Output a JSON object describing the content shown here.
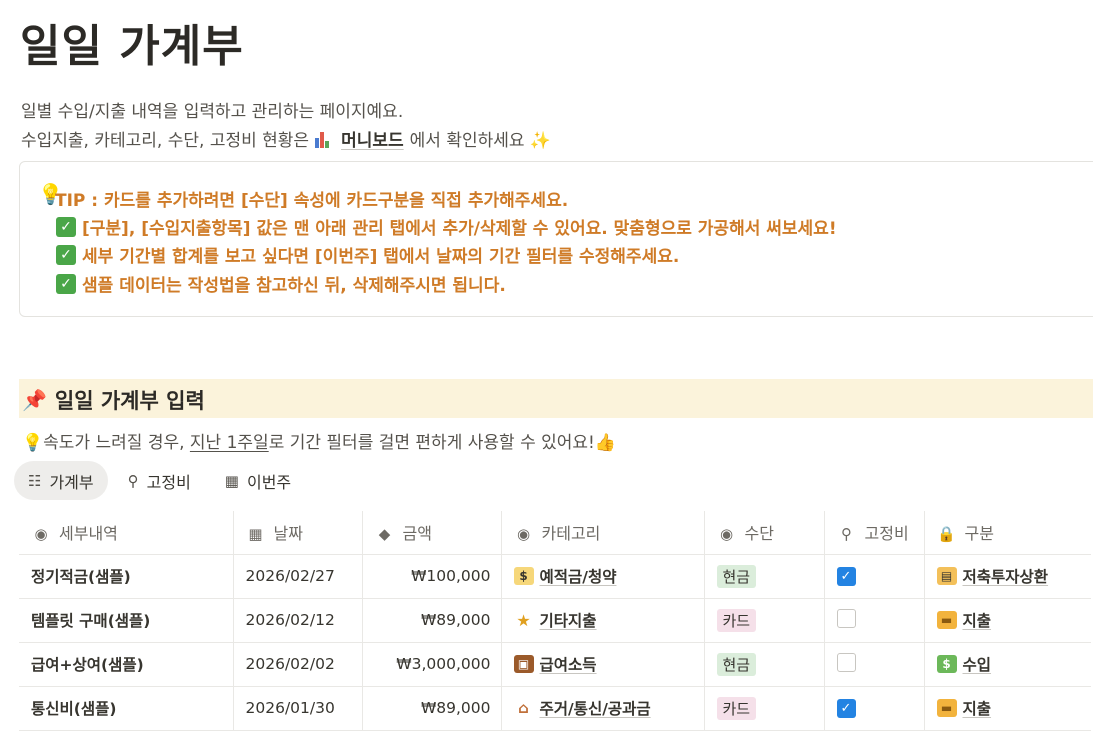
{
  "page": {
    "title": "일일 가계부",
    "desc_line1": "일별 수입/지출 내역을 입력하고 관리하는 페이지예요.",
    "desc_line2_before": "수입지출, 카테고리, 수단, 고정비 현황은",
    "desc_link": "머니보드",
    "desc_line2_after": "에서 확인하세요 ✨"
  },
  "callout": {
    "icon": "lightbulb-icon",
    "tip": "TIP : 카드를 추가하려면 [수단] 속성에 카드구분을 직접 추가해주세요.",
    "items": [
      "[구분], [수입지출항목] 값은 맨 아래 관리 탭에서 추가/삭제할 수 있어요. 맞춤형으로 가공해서 써보세요!",
      "세부 기간별 합계를 보고 싶다면 [이번주] 탭에서 날짜의 기간 필터를 수정해주세요.",
      "샘플 데이터는 작성법을 참고하신 뒤, 삭제해주시면 됩니다."
    ]
  },
  "section": {
    "title": "일일 가계부 입력",
    "note_before": "💡속도가 느려질 경우, ",
    "note_link": "지난 1주일",
    "note_after": "로 기간 필터를 걸면 편하게 사용할 수 있어요!👍"
  },
  "tabs": [
    {
      "label": "가계부",
      "icon": "table-icon",
      "active": true
    },
    {
      "label": "고정비",
      "icon": "pin-icon",
      "active": false
    },
    {
      "label": "이번주",
      "icon": "calendar-icon",
      "active": false
    }
  ],
  "table": {
    "columns": [
      {
        "label": "세부내역",
        "icon": "check-circle-icon"
      },
      {
        "label": "날짜",
        "icon": "calendar-icon"
      },
      {
        "label": "금액",
        "icon": "diamond-icon"
      },
      {
        "label": "카테고리",
        "icon": "check-circle-icon"
      },
      {
        "label": "수단",
        "icon": "check-circle-icon"
      },
      {
        "label": "고정비",
        "icon": "pin-icon"
      },
      {
        "label": "구분",
        "icon": "lock-icon"
      }
    ],
    "rows": [
      {
        "item": "정기적금(샘플)",
        "date": "2026/02/27",
        "amount": "₩100,000",
        "category": "예적금/청약",
        "category_icon": "money-bag-icon",
        "method": "현금",
        "fixed": true,
        "type": "저축투자상환",
        "type_icon": "piggy-icon"
      },
      {
        "item": "템플릿 구매(샘플)",
        "date": "2026/02/12",
        "amount": "₩89,000",
        "category": "기타지출",
        "category_icon": "star-icon",
        "method": "카드",
        "fixed": false,
        "type": "지출",
        "type_icon": "card-icon"
      },
      {
        "item": "급여+상여(샘플)",
        "date": "2026/02/02",
        "amount": "₩3,000,000",
        "category": "급여소득",
        "category_icon": "briefcase-icon",
        "method": "현금",
        "fixed": false,
        "type": "수입",
        "type_icon": "cash-icon"
      },
      {
        "item": "통신비(샘플)",
        "date": "2026/01/30",
        "amount": "₩89,000",
        "category": "주거/통신/공과금",
        "category_icon": "house-icon",
        "method": "카드",
        "fixed": true,
        "type": "지출",
        "type_icon": "card-icon"
      }
    ]
  },
  "colors": {
    "cash_pill_bg": "#dbeddb",
    "card_pill_bg": "#f5e0e9",
    "tip_text": "#cf7b27",
    "section_bg": "#fbf3db",
    "checkbox_on": "#2383e2"
  }
}
